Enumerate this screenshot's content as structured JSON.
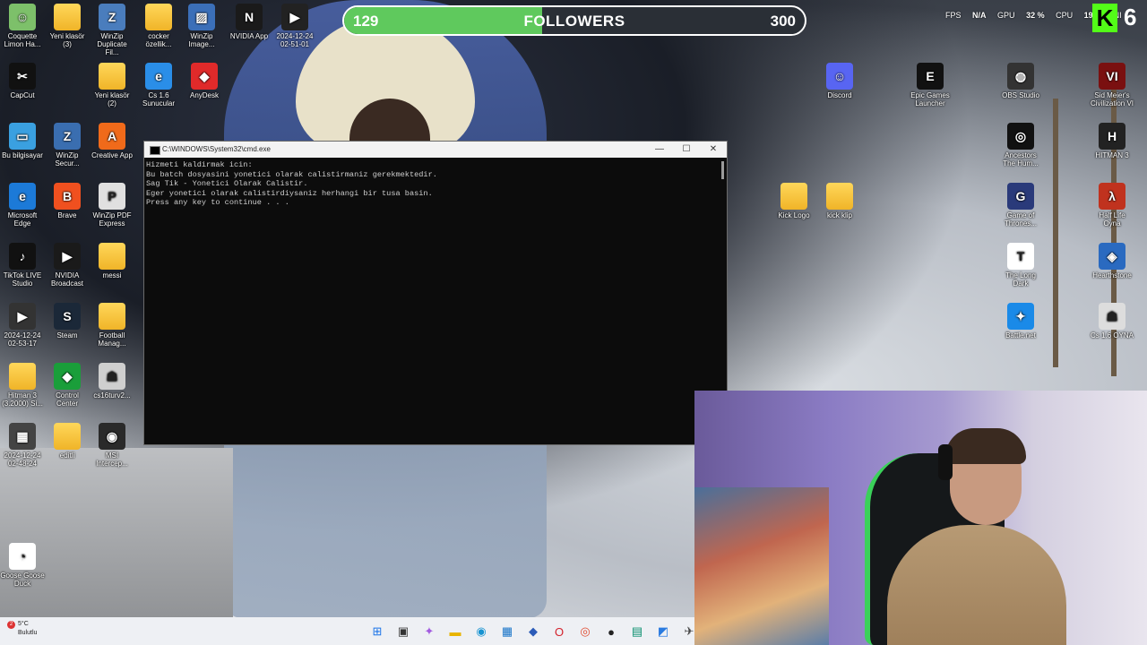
{
  "follower_goal": {
    "current": "129",
    "label": "FOLLOWERS",
    "target": "300",
    "progress_fraction": 0.43
  },
  "stats": {
    "fps_label": "FPS",
    "fps_value": "N/A",
    "gpu_label": "GPU",
    "gpu_value": "32 %",
    "cpu_label": "CPU",
    "cpu_value": "19 %",
    "extra": "NI",
    "kick_count": "6"
  },
  "desktop_icons": [
    {
      "label": "Coquette Limon Ha..."
    },
    {
      "label": "Yeni klasör (3)"
    },
    {
      "label": "WinZip Duplicate Fil..."
    },
    {
      "label": "cocker özellik..."
    },
    {
      "label": "WinZip Image..."
    },
    {
      "label": "NVIDIA App"
    },
    {
      "label": "2024-12-24 02-51-01"
    },
    {
      "label": "CapCut"
    },
    {
      "label": "Yeni klasör (2)"
    },
    {
      "label": "Cs 1.6 Sunucular"
    },
    {
      "label": "AnyDesk"
    },
    {
      "label": "Bu bilgisayar"
    },
    {
      "label": "WinZip Secur..."
    },
    {
      "label": "Creative App"
    },
    {
      "label": "Microsoft Edge"
    },
    {
      "label": "Brave"
    },
    {
      "label": "WinZip PDF Express"
    },
    {
      "label": "TikTok LIVE Studio"
    },
    {
      "label": "NVIDIA Broadcast"
    },
    {
      "label": "messi"
    },
    {
      "label": "2024-12-24 02-53-17"
    },
    {
      "label": "Steam"
    },
    {
      "label": "Football Manag..."
    },
    {
      "label": "Hitman 3 (3.2000) Si..."
    },
    {
      "label": "Control Center"
    },
    {
      "label": "cs16turv2..."
    },
    {
      "label": "2024-12-24 02-48-24"
    },
    {
      "label": "editli"
    },
    {
      "label": "MSI Intercep..."
    },
    {
      "label": "Goose Goose Duck"
    },
    {
      "label": "Discord"
    },
    {
      "label": "Epic Games Launcher"
    },
    {
      "label": "OBS Studio"
    },
    {
      "label": "Sid Meier's Civilization VI"
    },
    {
      "label": "Ancestors The Hum..."
    },
    {
      "label": "HITMAN 3"
    },
    {
      "label": "Kick Logo"
    },
    {
      "label": "kick klip"
    },
    {
      "label": "Game of Thrones..."
    },
    {
      "label": "Half Life Oyna"
    },
    {
      "label": "The Long Dark"
    },
    {
      "label": "Hearthstone"
    },
    {
      "label": "Battle.net"
    },
    {
      "label": "Cs 1.6 OYNA"
    }
  ],
  "cmd": {
    "title": "C:\\WINDOWS\\System32\\cmd.exe",
    "lines": [
      "Hizmeti kaldirmak icin:",
      "Bu batch dosyasini yonetici olarak calistirmaniz gerekmektedir.",
      "Sag Tik - Yonetici Olarak Calistir.",
      "Eger yonetici olarak calistirdiysaniz herhangi bir tusa basin.",
      "Press any key to continue . . ."
    ]
  },
  "weather": {
    "temp": "5°C",
    "desc": "Bulutlu",
    "badge": "2"
  }
}
